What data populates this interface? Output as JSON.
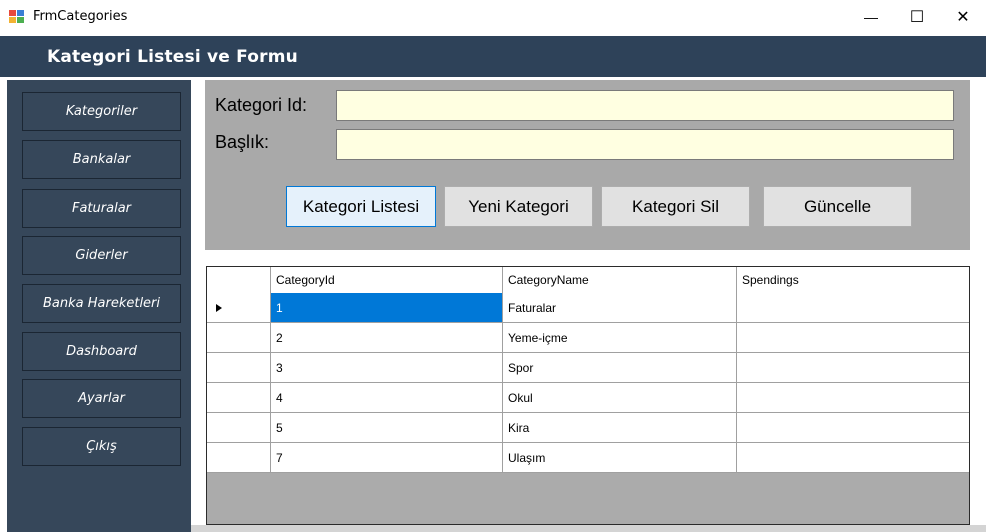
{
  "window": {
    "title": "FrmCategories",
    "minimize_glyph": "—",
    "maximize_glyph": "☐",
    "close_glyph": "✕",
    "icon": "winforms-app-icon"
  },
  "header": {
    "title": "Kategori Listesi ve Formu"
  },
  "sidebar": {
    "items": [
      {
        "label": "Kategoriler"
      },
      {
        "label": "Bankalar"
      },
      {
        "label": "Faturalar"
      },
      {
        "label": "Giderler"
      },
      {
        "label": "Banka Hareketleri"
      },
      {
        "label": "Dashboard"
      },
      {
        "label": "Ayarlar"
      },
      {
        "label": "Çıkış"
      }
    ]
  },
  "form": {
    "id_label": "Kategori Id:",
    "id_value": "",
    "title_label": "Başlık:",
    "title_value": "",
    "buttons": {
      "list": "Kategori Listesi",
      "new": "Yeni Kategori",
      "delete": "Kategori Sil",
      "update": "Güncelle"
    }
  },
  "grid": {
    "columns": [
      "CategoryId",
      "CategoryName",
      "Spendings"
    ],
    "rows": [
      {
        "id": "1",
        "name": "Faturalar",
        "spendings": ""
      },
      {
        "id": "2",
        "name": "Yeme-içme",
        "spendings": ""
      },
      {
        "id": "3",
        "name": "Spor",
        "spendings": ""
      },
      {
        "id": "4",
        "name": "Okul",
        "spendings": ""
      },
      {
        "id": "5",
        "name": "Kira",
        "spendings": ""
      },
      {
        "id": "7",
        "name": "Ulaşım",
        "spendings": ""
      }
    ],
    "selected_row": 0
  },
  "colors": {
    "header_bg": "#2e4259",
    "sidebar_bg": "#36475a",
    "panel_bg": "#a9a9a9",
    "input_bg": "#ffffe1",
    "selection": "#0078d7"
  }
}
